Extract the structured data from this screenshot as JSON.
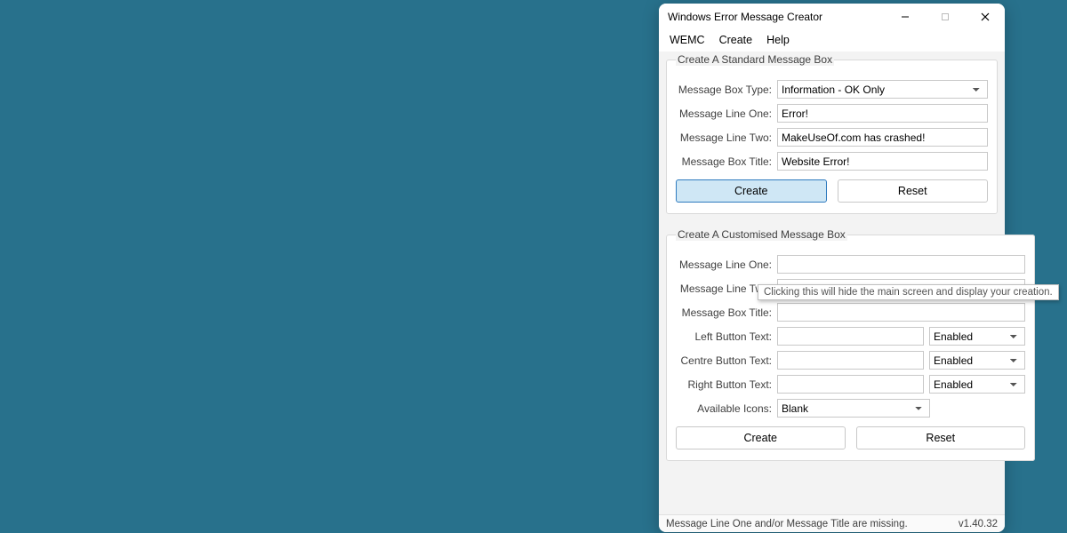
{
  "window": {
    "title": "Windows Error Message Creator"
  },
  "menu": {
    "wemc": "WEMC",
    "create": "Create",
    "help": "Help"
  },
  "standard": {
    "legend": "Create A Standard Message Box",
    "type_label": "Message Box Type:",
    "type_value": "Information - OK Only",
    "line1_label": "Message Line One:",
    "line1_value": "Error!",
    "line2_label": "Message Line Two:",
    "line2_value": "MakeUseOf.com has crashed!",
    "title_label": "Message Box Title:",
    "title_value": "Website Error!",
    "create_btn": "Create",
    "reset_btn": "Reset"
  },
  "tooltip": "Clicking this will hide the main screen and display your creation.",
  "custom": {
    "legend": "Create A Customised Message Box",
    "line1_label": "Message Line One:",
    "line1_value": "",
    "line2_label": "Message Line Two:",
    "line2_value": "",
    "title_label": "Message Box Title:",
    "title_value": "",
    "left_label": "Left Button Text:",
    "left_value": "",
    "left_state": "Enabled",
    "centre_label": "Centre Button Text:",
    "centre_value": "",
    "centre_state": "Enabled",
    "right_label": "Right Button Text:",
    "right_value": "",
    "right_state": "Enabled",
    "icons_label": "Available Icons:",
    "icons_value": "Blank",
    "create_btn": "Create",
    "reset_btn": "Reset"
  },
  "status": {
    "message": "Message Line One and/or Message Title are missing.",
    "version": "v1.40.32"
  }
}
